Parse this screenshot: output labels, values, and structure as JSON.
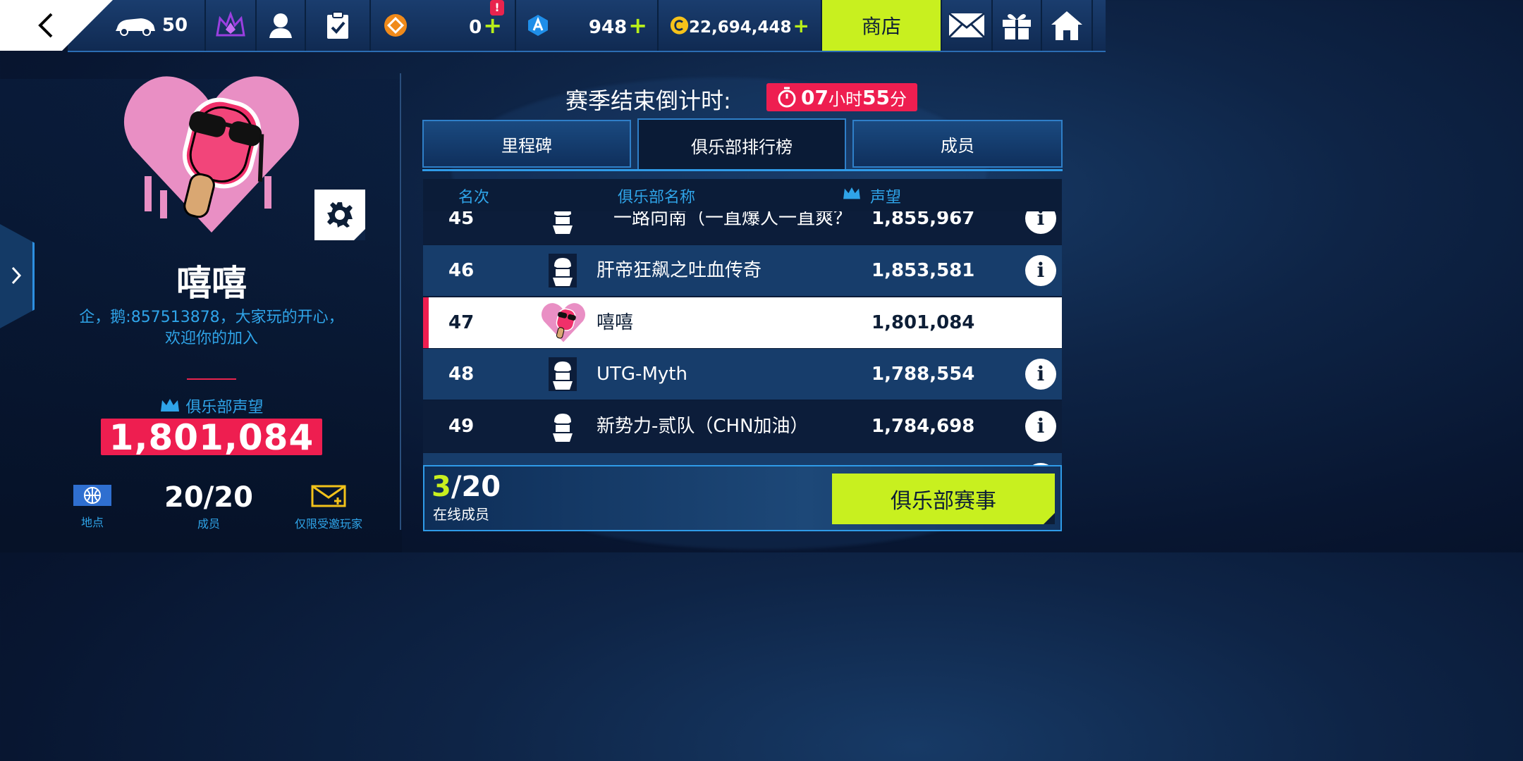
{
  "topbar": {
    "car_count": "50",
    "tokens": "0",
    "blue_points": "948",
    "credits": "22,694,448",
    "shop_label": "商店",
    "notification_badge": "!"
  },
  "left": {
    "club_name": "嘻嘻",
    "description_line1": "企，鹅:857513878，大家玩的开心，",
    "description_line2": "欢迎你的加入",
    "reputation_label": "俱乐部声望",
    "reputation_value": "1,801,084",
    "location_label": "地点",
    "members_value": "20/20",
    "members_label": "成员",
    "invite_label": "仅限受邀玩家"
  },
  "countdown": {
    "label": "赛季结束倒计时:",
    "hours": "07",
    "hours_unit": "小时",
    "minutes": "55",
    "minutes_unit": "分"
  },
  "tabs": [
    {
      "label": "里程碑"
    },
    {
      "label": "俱乐部排行榜"
    },
    {
      "label": "成员"
    }
  ],
  "table": {
    "headers": {
      "rank": "名次",
      "name": "俱乐部名称",
      "reputation": "声望"
    },
    "rows": [
      {
        "rank": "45",
        "name": "一路向南（一直爆人一直爽？",
        "score": "1,855,967"
      },
      {
        "rank": "46",
        "name": "肝帝狂飙之吐血传奇",
        "score": "1,853,581"
      },
      {
        "rank": "47",
        "name": "嘻嘻",
        "score": "1,801,084"
      },
      {
        "rank": "48",
        "name": "UTG-Myth",
        "score": "1,788,554"
      },
      {
        "rank": "49",
        "name": "新势力-贰队（CHN加油）",
        "score": "1,784,698"
      }
    ]
  },
  "bottom": {
    "online_current": "3",
    "online_total": "/20",
    "online_label": "在线成员",
    "club_event_label": "俱乐部赛事"
  }
}
